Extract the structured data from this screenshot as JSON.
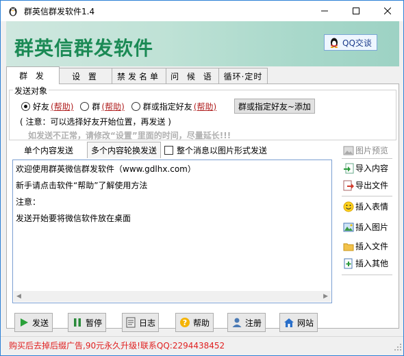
{
  "window": {
    "title": "群英信群发软件1.4"
  },
  "banner": {
    "title": "群英信群发软件",
    "qq_button": "QQ交谈"
  },
  "tabs": [
    "群 发",
    "设 置",
    "禁发名单",
    "问 候 语",
    "循环·定时"
  ],
  "send_target": {
    "legend": "发送对象",
    "options": [
      {
        "label": "好友",
        "help": "(帮助)",
        "checked": true
      },
      {
        "label": "群",
        "help": "(帮助)",
        "checked": false
      },
      {
        "label": "群或指定好友",
        "help": "(帮助)",
        "checked": false
      }
    ],
    "add_button": "群或指定好友~添加",
    "note": "( 注意：可以选择好友开始位置，再发送 )",
    "warning": "如发送不正常，请修改“设置”里面的时间，尽量延长!!!"
  },
  "subtabs": [
    "单个内容发送",
    "多个内容轮换发送"
  ],
  "image_send_checkbox": "整个消息以图片形式发送",
  "editor": {
    "lines": [
      "欢迎使用群英微信群发软件（www.gdlhx.com）",
      "新手请点击软件“帮助”了解使用方法",
      "注意：",
      "发送开始要将微信软件放在桌面"
    ]
  },
  "side_actions": {
    "preview": "图片预览",
    "import": "导入内容",
    "export": "导出文件",
    "insert_emoji": "插入表情",
    "insert_image": "插入图片",
    "insert_file": "插入文件",
    "insert_other": "插入其他"
  },
  "bottom_buttons": {
    "send": "发送",
    "pause": "暂停",
    "log": "日志",
    "help": "帮助",
    "register": "注册",
    "website": "网站"
  },
  "status": "购买后去掉后缀广告,90元永久升级!联系QQ:2294438452",
  "colors": {
    "banner_text": "#1b8a55",
    "status_text": "#e02020",
    "help_link": "#b02020"
  }
}
